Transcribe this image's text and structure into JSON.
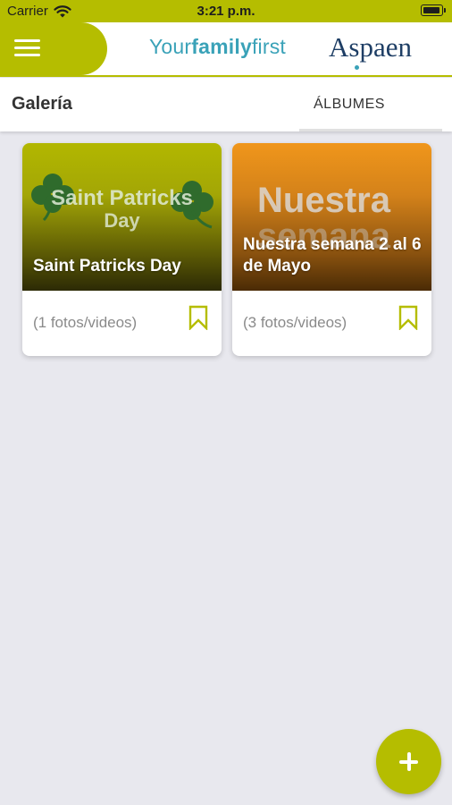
{
  "status_bar": {
    "carrier": "Carrier",
    "time": "3:21 p.m."
  },
  "header": {
    "brand_regular": "Your",
    "brand_bold": "family",
    "brand_end": "first",
    "partner_logo": "Aspaen"
  },
  "sub_header": {
    "title": "Galería",
    "tab_label": "ÁLBUMES"
  },
  "albums": [
    {
      "image_text_line1": "Saint Patricks",
      "image_text_line2": "Day",
      "title": "Saint Patricks Day",
      "count": "(1 fotos/videos)"
    },
    {
      "image_text_line1": "Nuestra",
      "image_text_line2": "semana",
      "title_line1": "Nuestra semana 2 al 6",
      "title_line2": "de Mayo",
      "count": "(3 fotos/videos)"
    }
  ],
  "colors": {
    "accent": "#b5bd00",
    "brand_blue": "#3aa2b8",
    "partner_navy": "#1e3e65",
    "background": "#e8e8ee"
  },
  "icons": {
    "menu": "hamburger-icon",
    "wifi": "wifi-icon",
    "battery": "battery-icon",
    "bookmark": "bookmark-icon",
    "add": "plus-icon"
  }
}
